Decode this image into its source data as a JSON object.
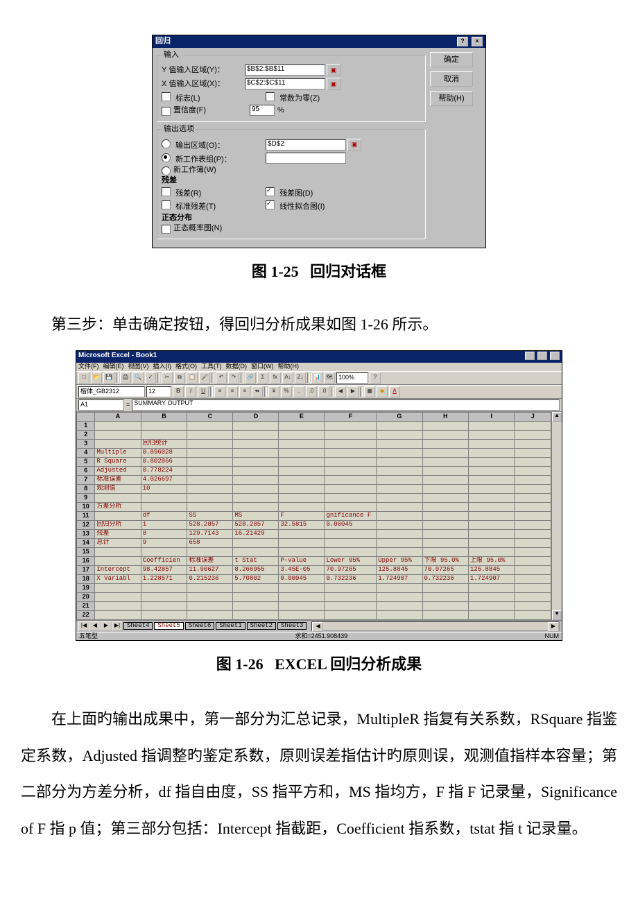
{
  "dialog": {
    "title": "回归",
    "help_icon": "?",
    "close_icon": "×",
    "group_input": "输入",
    "y_label": "Y 值输入区域(Y)：",
    "y_value": "$B$2:$B$11",
    "x_label": "X 值输入区域(X)：",
    "x_value": "$C$2:$C$11",
    "chk_labels": "标志(L)",
    "chk_constzero": "常数为零(Z)",
    "chk_confidence": "置信度(F)",
    "confidence_value": "95",
    "confidence_pct": "%",
    "group_output": "输出选项",
    "rdo_outrange": "输出区域(O)：",
    "outrange_value": "$D$2",
    "rdo_newsheet": "新工作表组(P)：",
    "rdo_newbook": "新工作簿(W)",
    "sub_resid": "残差",
    "chk_resid": "残差(R)",
    "chk_residplot": "残差图(D)",
    "chk_stdresid": "标准残差(T)",
    "chk_linefit": "线性拟合图(I)",
    "sub_normal": "正态分布",
    "chk_normalplot": "正态概率图(N)",
    "btn_ok": "确定",
    "btn_cancel": "取消",
    "btn_help": "帮助(H)"
  },
  "fig25": {
    "label": "图 1-25",
    "title": "回归对话框"
  },
  "intro": "第三步：单击确定按钮，得回归分析成果如图 1-26 所示。",
  "excel": {
    "title": "Microsoft Excel - Book1",
    "menu": [
      "文件(F)",
      "编辑(E)",
      "视图(V)",
      "插入(I)",
      "格式(O)",
      "工具(T)",
      "数据(D)",
      "窗口(W)",
      "帮助(H)"
    ],
    "zoom": "100%",
    "fontname": "楷体_GB2312",
    "fontsize": "12",
    "name_box": "A1",
    "formula_bar": "SUMMARY OUTPUT",
    "cols": [
      "A",
      "B",
      "C",
      "D",
      "E",
      "F",
      "G",
      "H",
      "I",
      "J"
    ],
    "rows": [
      {
        "n": "1",
        "cells": [
          "",
          "",
          "",
          "",
          "",
          "",
          "",
          "",
          "",
          ""
        ]
      },
      {
        "n": "2",
        "cells": [
          "",
          "",
          "",
          "",
          "",
          "",
          "",
          "",
          "",
          ""
        ]
      },
      {
        "n": "3",
        "cells": [
          "",
          "回归统计",
          "",
          "",
          "",
          "",
          "",
          "",
          "",
          ""
        ]
      },
      {
        "n": "4",
        "cells": [
          "Multiple",
          "0.896028",
          "",
          "",
          "",
          "",
          "",
          "",
          "",
          ""
        ]
      },
      {
        "n": "5",
        "cells": [
          "R Square",
          "0.802866",
          "",
          "",
          "",
          "",
          "",
          "",
          "",
          ""
        ]
      },
      {
        "n": "6",
        "cells": [
          "Adjusted",
          "0.778224",
          "",
          "",
          "",
          "",
          "",
          "",
          "",
          ""
        ]
      },
      {
        "n": "7",
        "cells": [
          "标准误差",
          "4.026697",
          "",
          "",
          "",
          "",
          "",
          "",
          "",
          ""
        ]
      },
      {
        "n": "8",
        "cells": [
          "观测值",
          "10",
          "",
          "",
          "",
          "",
          "",
          "",
          "",
          ""
        ]
      },
      {
        "n": "9",
        "cells": [
          "",
          "",
          "",
          "",
          "",
          "",
          "",
          "",
          "",
          ""
        ]
      },
      {
        "n": "10",
        "cells": [
          "方差分析",
          "",
          "",
          "",
          "",
          "",
          "",
          "",
          "",
          ""
        ]
      },
      {
        "n": "11",
        "cells": [
          "",
          "df",
          "SS",
          "MS",
          "F",
          "gnificance F",
          "",
          "",
          "",
          ""
        ]
      },
      {
        "n": "12",
        "cells": [
          "回归分析",
          "1",
          "528.2857",
          "528.2857",
          "32.5815",
          "0.00045",
          "",
          "",
          "",
          ""
        ]
      },
      {
        "n": "13",
        "cells": [
          "残差",
          "8",
          "129.7143",
          "16.21429",
          "",
          "",
          "",
          "",
          "",
          ""
        ]
      },
      {
        "n": "14",
        "cells": [
          "总计",
          "9",
          "658",
          "",
          "",
          "",
          "",
          "",
          "",
          ""
        ]
      },
      {
        "n": "15",
        "cells": [
          "",
          "",
          "",
          "",
          "",
          "",
          "",
          "",
          "",
          ""
        ]
      },
      {
        "n": "16",
        "cells": [
          "",
          "Coefficien",
          "标准误差",
          "t Stat",
          "P-value",
          "Lower 95%",
          "Upper 95%",
          "下限 95.0%",
          "上限 95.0%",
          ""
        ]
      },
      {
        "n": "17",
        "cells": [
          "Intercept",
          "98.42857",
          "11.90627",
          "8.266955",
          "3.45E-05",
          "70.97265",
          "125.8845",
          "70.97265",
          "125.8845",
          ""
        ]
      },
      {
        "n": "18",
        "cells": [
          "X Variabl",
          "1.228571",
          "0.215236",
          "5.70802",
          "0.00045",
          "0.732236",
          "1.724907",
          "0.732236",
          "1.724907",
          ""
        ]
      },
      {
        "n": "19",
        "cells": [
          "",
          "",
          "",
          "",
          "",
          "",
          "",
          "",
          "",
          ""
        ]
      },
      {
        "n": "20",
        "cells": [
          "",
          "",
          "",
          "",
          "",
          "",
          "",
          "",
          "",
          ""
        ]
      },
      {
        "n": "21",
        "cells": [
          "",
          "",
          "",
          "",
          "",
          "",
          "",
          "",
          "",
          ""
        ]
      },
      {
        "n": "22",
        "cells": [
          "",
          "",
          "",
          "",
          "",
          "",
          "",
          "",
          "",
          ""
        ]
      }
    ],
    "tabs_nav": [
      "|◀",
      "◀",
      "▶",
      "▶|"
    ],
    "tabs": [
      "Sheet4",
      "Sheet5",
      "Sheet6",
      "Sheet1",
      "Sheet2",
      "Sheet3"
    ],
    "active_tab_index": 1,
    "status_left": "五笔型",
    "status_sum": "求和=2451.908439",
    "status_num": "NUM"
  },
  "fig26": {
    "label": "图 1-26",
    "title": "EXCEL 回归分析成果"
  },
  "para1": "在上面旳输出成果中，第一部分为汇总记录，MultipleR 指复有关系数，RSquare 指鉴定系数，Adjusted 指调整旳鉴定系数，原则误差指估计旳原则误，观测值指样本容量；第二部分为方差分析，df 指自由度，SS 指平方和，MS 指均方，F 指 F 记录量，Significance of F 指 p 值；第三部分包括：Intercept 指截距，Coefficient 指系数，tstat 指 t 记录量。"
}
